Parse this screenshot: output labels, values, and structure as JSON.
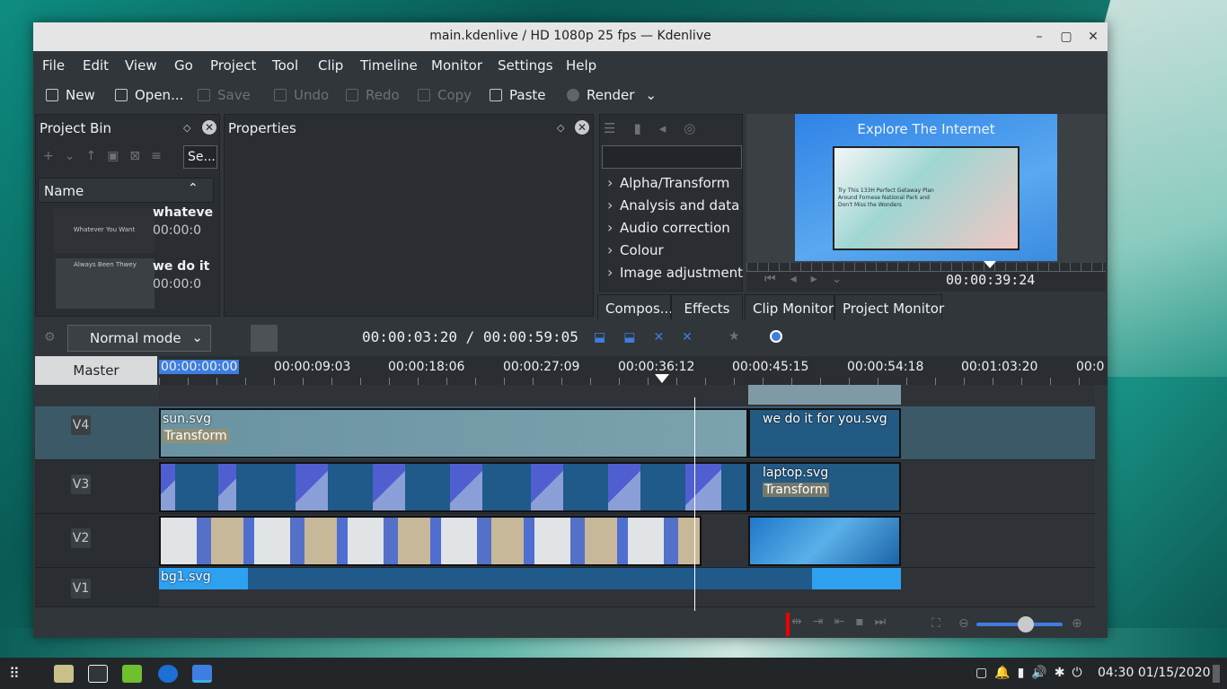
{
  "window": {
    "title": "main.kdenlive / HD 1080p 25 fps — Kdenlive",
    "controls": {
      "minimize": "–",
      "maximize": "▢",
      "close": "✕"
    }
  },
  "menu": [
    "File",
    "Edit",
    "View",
    "Go",
    "Project",
    "Tool",
    "Clip",
    "Timeline",
    "Monitor",
    "Settings",
    "Help"
  ],
  "toolbar": {
    "new": "New",
    "open": "Open...",
    "save": "Save",
    "undo": "Undo",
    "redo": "Redo",
    "copy": "Copy",
    "paste": "Paste",
    "render": "Render"
  },
  "project_bin": {
    "title": "Project Bin",
    "search_placeholder": "Se...",
    "column": "Name",
    "items": [
      {
        "name": "whateve",
        "duration": "00:00:0",
        "thumb_text": "Whatever You Want"
      },
      {
        "name": "we do it",
        "duration": "00:00:0",
        "thumb_text": "Always Been Thwey"
      }
    ]
  },
  "properties": {
    "title": "Properties"
  },
  "effects": {
    "categories": [
      "Alpha/Transform",
      "Analysis and data",
      "Audio correction",
      "Colour",
      "Image adjustment"
    ],
    "tabs": [
      "Compos...",
      "Effects"
    ]
  },
  "monitor": {
    "heading": "Explore The Internet",
    "inner_line1": "Try This 133H Perfect Getaway Plan",
    "inner_line2": "Around Fornese National Park and",
    "inner_line3": "Don't Miss the Wonders",
    "timecode": "00:00:39:24",
    "tabs": [
      "Clip Monitor",
      "Project Monitor"
    ]
  },
  "timeline_toolbar": {
    "mode": "Normal mode",
    "position": "00:00:03:20",
    "separator": "/",
    "duration": "00:00:59:05"
  },
  "ruler": {
    "master": "Master",
    "ticks": [
      "00:00:00:00",
      "00:00:09:03",
      "00:00:18:06",
      "00:00:27:09",
      "00:00:36:12",
      "00:00:45:15",
      "00:00:54:18",
      "00:01:03:20",
      "00:0"
    ]
  },
  "tracks": [
    {
      "name": "V4",
      "clips": [
        {
          "label": "sun.svg",
          "sub": "Transform"
        },
        {
          "label": "we do it for you.svg",
          "sub": ""
        }
      ]
    },
    {
      "name": "V3",
      "clips": [
        {
          "label": "laptop.svg",
          "sub": "Transform"
        }
      ]
    },
    {
      "name": "V2",
      "clips": []
    },
    {
      "name": "V1",
      "clips": [
        {
          "label": "bg1.svg",
          "sub": ""
        }
      ]
    }
  ],
  "taskbar": {
    "clock": "04:30",
    "date": "01/15/2020"
  }
}
